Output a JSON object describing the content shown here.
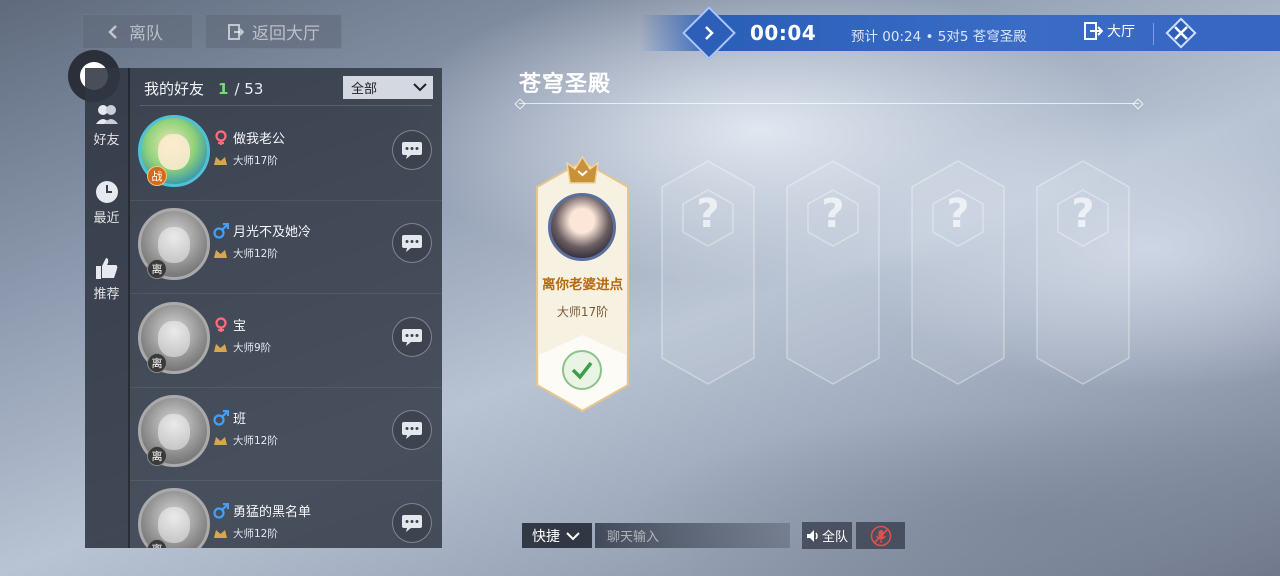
{
  "header": {
    "leave_label": "离队",
    "return_label": "返回大厅"
  },
  "sidebar": {
    "tabs": [
      {
        "label": "好友",
        "icon": "friends-icon"
      },
      {
        "label": "最近",
        "icon": "clock-icon"
      },
      {
        "label": "推荐",
        "icon": "thumbs-up-icon"
      }
    ]
  },
  "friends": {
    "title": "我的好友",
    "online": "1",
    "total": "/ 53",
    "filter": "全部",
    "list": [
      {
        "name": "做我老公",
        "gender": "female",
        "rank": "大师17阶",
        "status": "战",
        "online": true
      },
      {
        "name": "月光不及她冷",
        "gender": "male",
        "rank": "大师12阶",
        "status": "离",
        "online": false
      },
      {
        "name": "宝",
        "gender": "female",
        "rank": "大师9阶",
        "status": "离",
        "online": false
      },
      {
        "name": "班",
        "gender": "male",
        "rank": "大师12阶",
        "status": "离",
        "online": false
      },
      {
        "name": "勇猛的黑名单",
        "gender": "male",
        "rank": "大师12阶",
        "status": "离",
        "online": false
      }
    ]
  },
  "match": {
    "timer": "00:04",
    "estimate": "预计 00:24 • 5对5 苍穹圣殿",
    "lobby_label": "大厅"
  },
  "room": {
    "title": "苍穹圣殿",
    "player": {
      "name": "离你老婆进点",
      "rank": "大师17阶"
    },
    "empty_slot_mark": "?"
  },
  "chat": {
    "quick_label": "快捷",
    "input_placeholder": "聊天输入",
    "team_label": "全队"
  },
  "colors": {
    "online_count": "#6fe06f",
    "match_bar": "#3466c2",
    "player_name": "#b56a12",
    "male": "#3ea1ff",
    "female": "#ff6b7a"
  }
}
